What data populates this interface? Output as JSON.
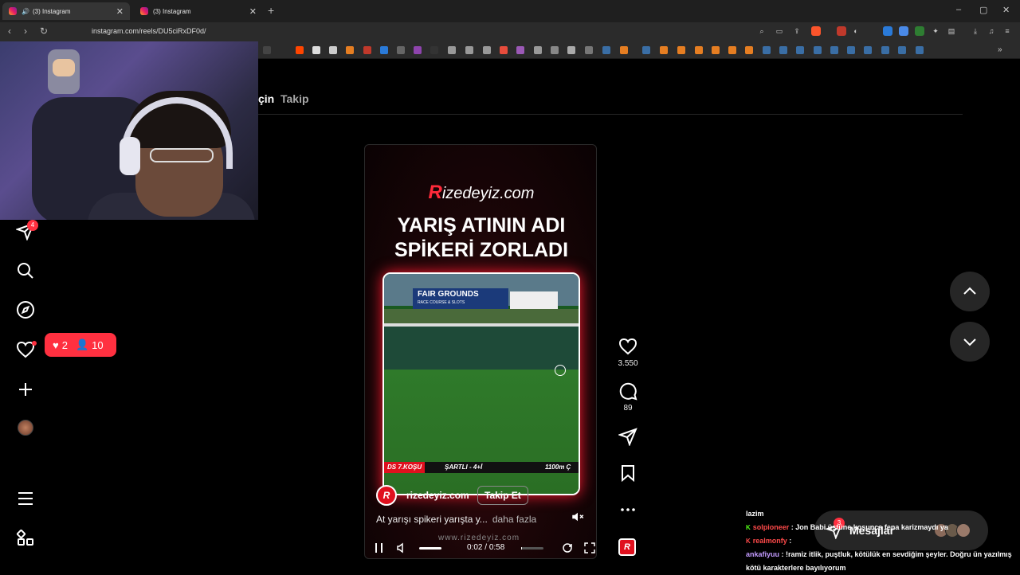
{
  "browser": {
    "tabs": [
      {
        "label": "(3) Instagram",
        "active": true
      },
      {
        "label": "(3) Instagram",
        "active": false
      }
    ],
    "url": "instagram.com/reels/DU5ciRxDF0d/",
    "new_tab": "+",
    "window_controls": {
      "minimize": "–",
      "restore": "▢",
      "close": "✕"
    }
  },
  "feed_tabs": {
    "for_you": "çin",
    "following": "Takip"
  },
  "sidebar": {
    "messages_badge": "4",
    "notifications_pill": {
      "likes": "2",
      "follows": "10"
    }
  },
  "reel": {
    "brand_prefix": "R",
    "brand_rest": "izedeyiz.com",
    "headline_1": "YARIŞ ATININ ADI",
    "headline_2": "SPİKERİ ZORLADI",
    "video": {
      "banner_title": "FAIR GROUNDS",
      "banner_sub": "RACE COURSE & SLOTS",
      "race_strip": "DS 7.KOŞU",
      "race_condition": "ŞARTLI - 4+İ",
      "race_distance": "1100m Ç"
    },
    "author": "rizedeyiz.com",
    "author_logo": "R",
    "follow_label": "Takip Et",
    "caption": "At yarışı spikeri yarışta y...",
    "caption_more": "daha fazla",
    "watermark": "www.rizedeyiz.com",
    "time_current": "0:02",
    "time_separator": "/",
    "time_total": "0:58",
    "progress_fraction": 0.034
  },
  "actions": {
    "likes": "3.550",
    "comments": "89"
  },
  "messages": {
    "label": "Mesajlar",
    "badge": "3"
  },
  "chat": {
    "lines": [
      {
        "user": "",
        "text": "lazim"
      },
      {
        "user": "solpioneer",
        "text": "Jon Babi üstüne koşunca fena karizmaydı ya"
      },
      {
        "user": "realmonfy",
        "text": ""
      },
      {
        "user": "ankafiyuu",
        "text": "!ramiz itlik, puştluk, kötülük en sevdiğim şeyler. Doğru ün yazılmış kötü karakterlere bayılıyorum"
      }
    ]
  },
  "colors": {
    "accent_red": "#ff3040",
    "brand_red": "#e0101e",
    "kick_green": "#53fc18"
  }
}
